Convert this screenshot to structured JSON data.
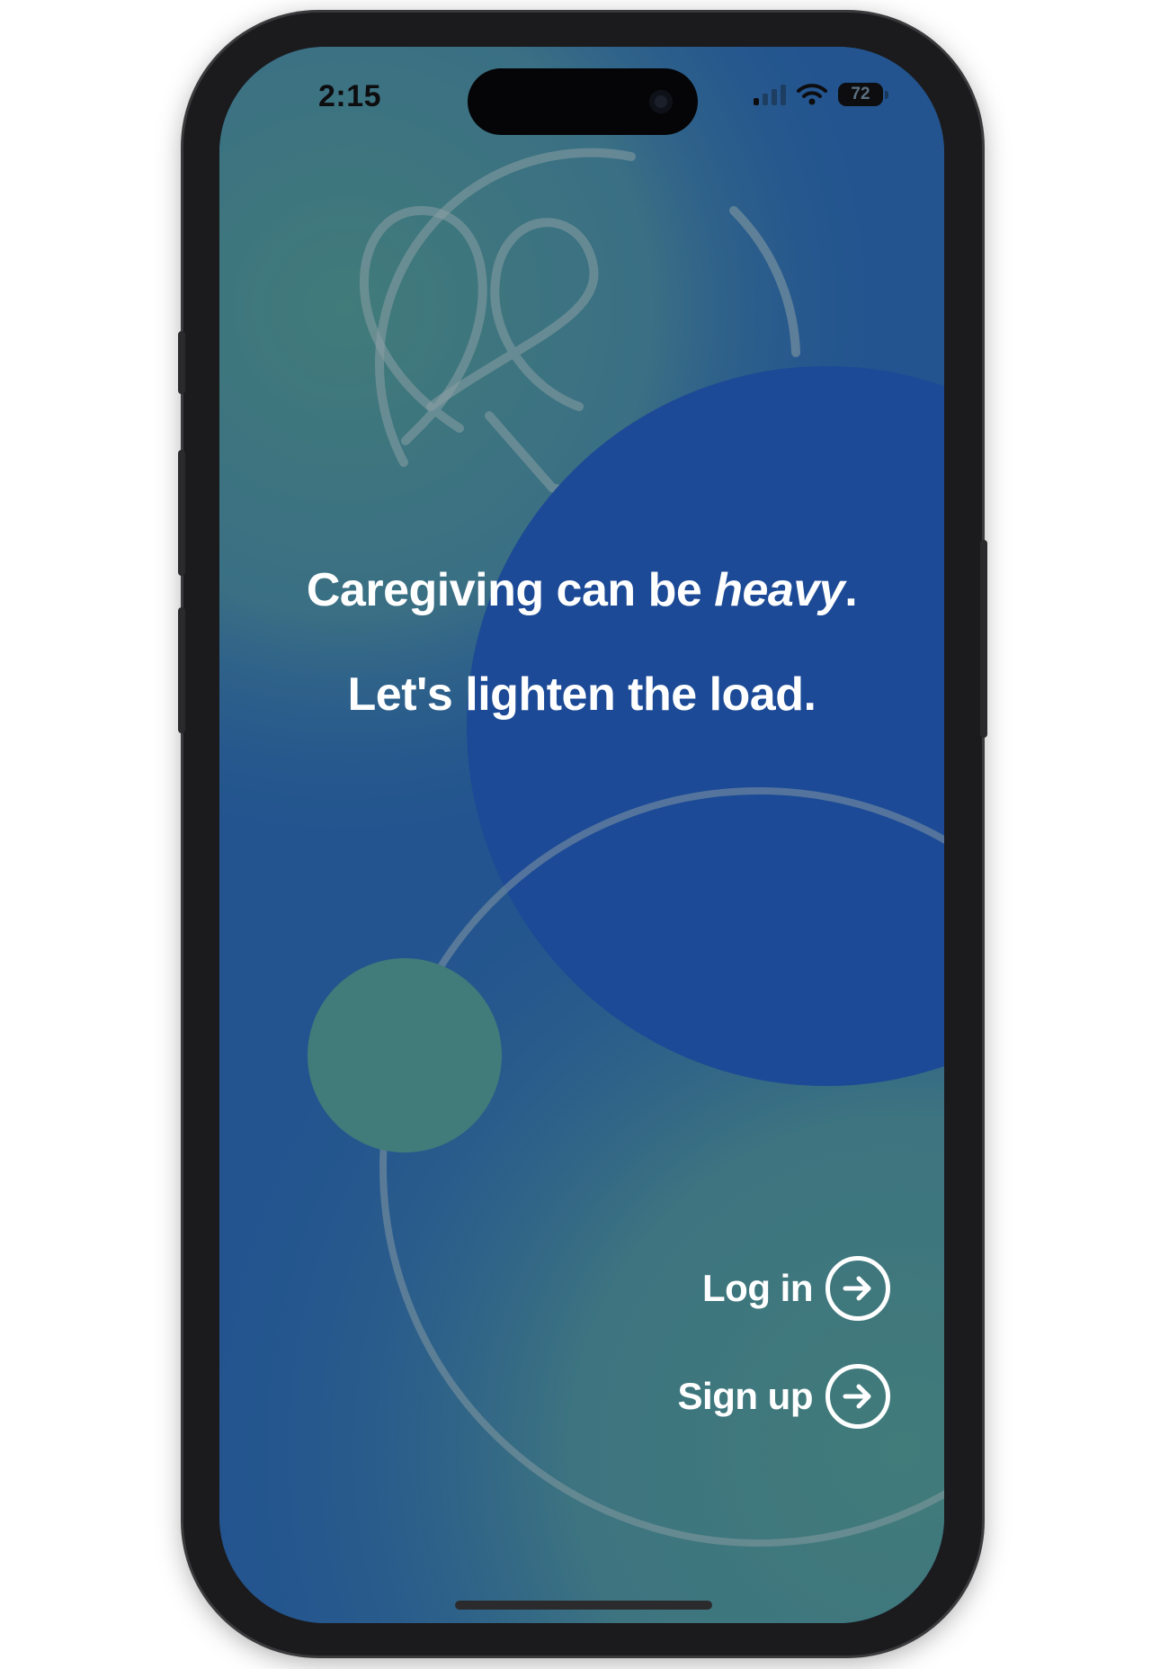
{
  "status_bar": {
    "time": "2:15",
    "battery_level": "72",
    "signal_icon": "cellular-signal-icon",
    "wifi_icon": "wifi-icon"
  },
  "hero": {
    "line1_prefix": "Caregiving can be ",
    "line1_emphasis": "heavy",
    "line1_suffix": ".",
    "line2": "Let's lighten the load."
  },
  "actions": {
    "login_label": "Log in",
    "signup_label": "Sign up",
    "arrow_icon": "arrow-right-circle-icon"
  },
  "colors": {
    "teal": "#417b7a",
    "blue": "#23548f",
    "deep_blue": "#1c4a96",
    "text": "#ffffff"
  }
}
